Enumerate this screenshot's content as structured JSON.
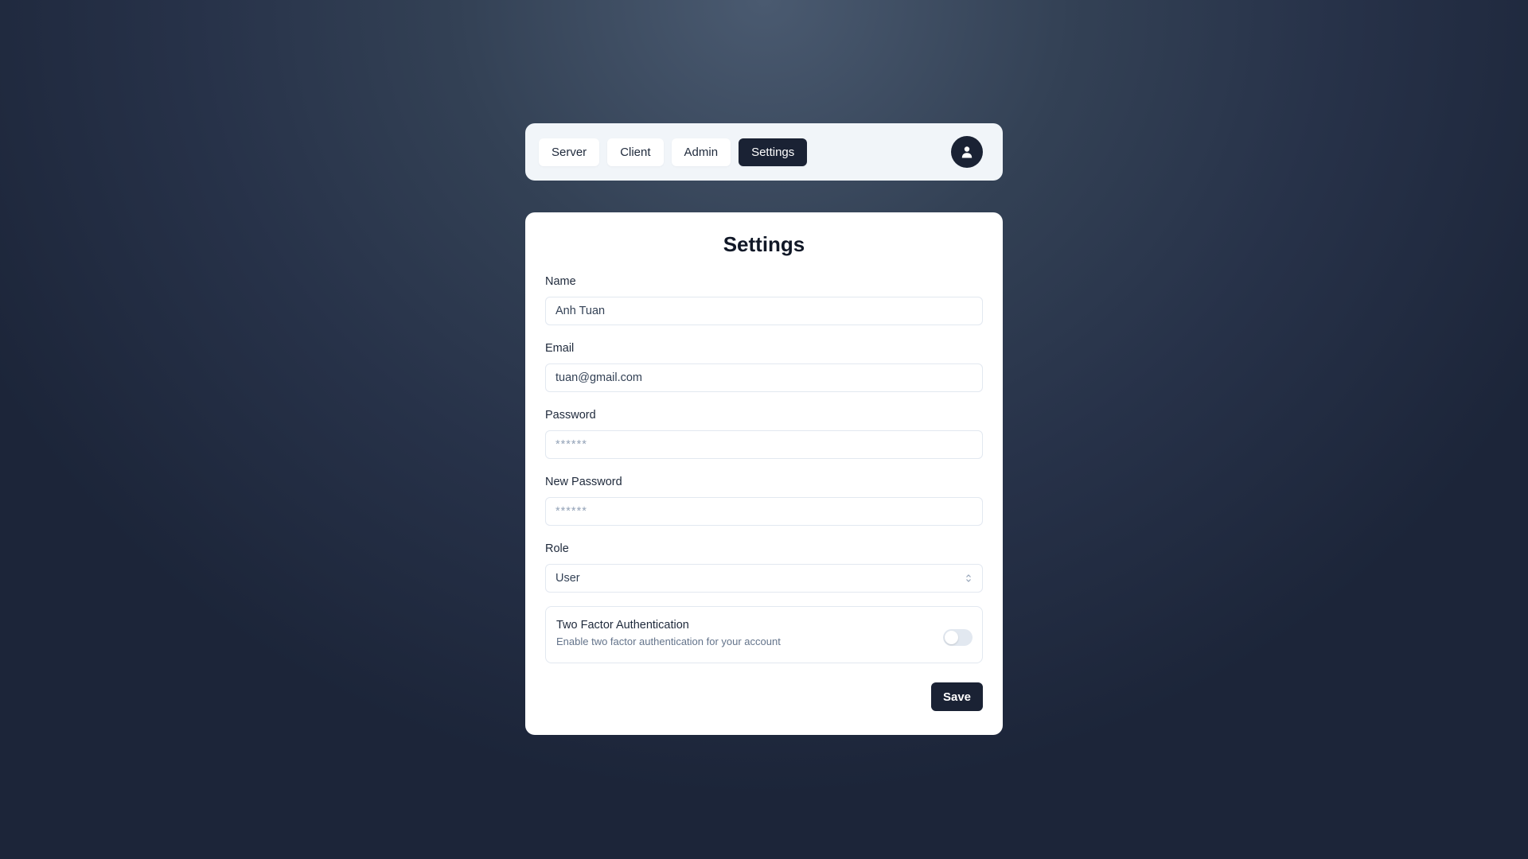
{
  "navbar": {
    "tabs": [
      {
        "label": "Server",
        "active": false
      },
      {
        "label": "Client",
        "active": false
      },
      {
        "label": "Admin",
        "active": false
      },
      {
        "label": "Settings",
        "active": true
      }
    ],
    "avatar_icon": "user-icon"
  },
  "settings": {
    "title": "Settings",
    "fields": {
      "name": {
        "label": "Name",
        "value": "Anh Tuan",
        "placeholder": ""
      },
      "email": {
        "label": "Email",
        "value": "tuan@gmail.com",
        "placeholder": ""
      },
      "password": {
        "label": "Password",
        "value": "",
        "placeholder": "******"
      },
      "new_password": {
        "label": "New Password",
        "value": "",
        "placeholder": "******"
      },
      "role": {
        "label": "Role",
        "value": "User"
      }
    },
    "two_factor": {
      "title": "Two Factor Authentication",
      "description": "Enable two factor authentication for your account",
      "enabled": false
    },
    "save_label": "Save"
  },
  "colors": {
    "primary": "#1a2234",
    "navbar_bg": "#f1f5f9",
    "border": "#e2e8f0",
    "muted_text": "#64748b"
  }
}
